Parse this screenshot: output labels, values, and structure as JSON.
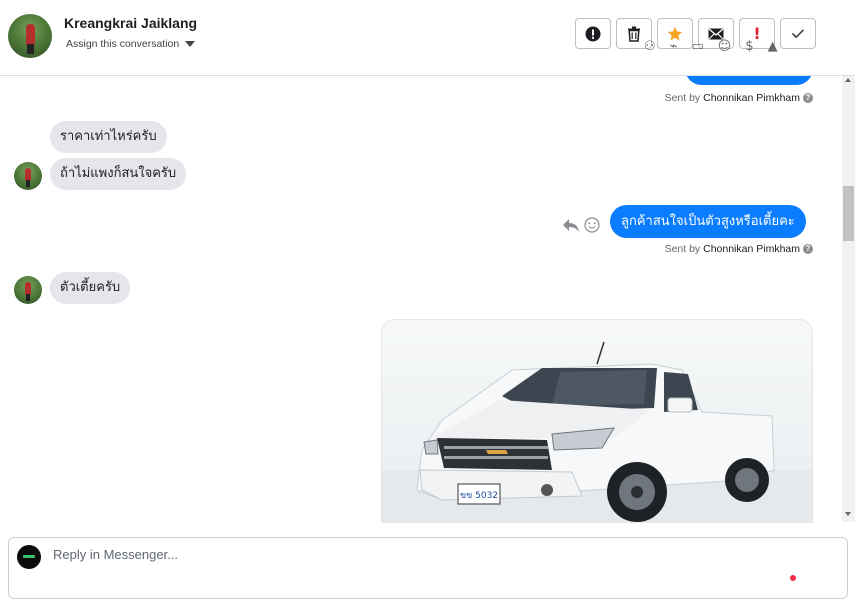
{
  "header": {
    "contact_name": "Kreangkrai Jaiklang",
    "assign_label": "Assign this conversation",
    "toolbar": [
      {
        "name": "mark-spam-button",
        "icon": "alert-circle-icon"
      },
      {
        "name": "delete-button",
        "icon": "trash-icon"
      },
      {
        "name": "star-button",
        "icon": "star-icon"
      },
      {
        "name": "mark-unread-button",
        "icon": "envelope-icon"
      },
      {
        "name": "mark-important-button",
        "icon": "exclamation-icon"
      },
      {
        "name": "mark-done-button",
        "icon": "check-icon"
      }
    ]
  },
  "messages": {
    "sent_by_prefix": "Sent by",
    "sender_name": "Chonnikan Pimkham",
    "help_glyph": "?",
    "m1": "ราคาเท่าไหร่ครับ",
    "m2": "ถ้าไม่แพงก็สนใจครับ",
    "m3": "ลูกค้าสนใจเป็นตัวสูงหรือเตี้ยคะ",
    "m4": "ตัวเตี้ยครับ"
  },
  "car_image": {
    "plate_text": "ขข 5032"
  },
  "composer": {
    "placeholder": "Reply in Messenger..."
  },
  "colors": {
    "outgoing_bubble": "#0a7cff",
    "incoming_bubble": "#e4e6eb",
    "star": "#f5a623",
    "exclamation": "#e0202f"
  }
}
